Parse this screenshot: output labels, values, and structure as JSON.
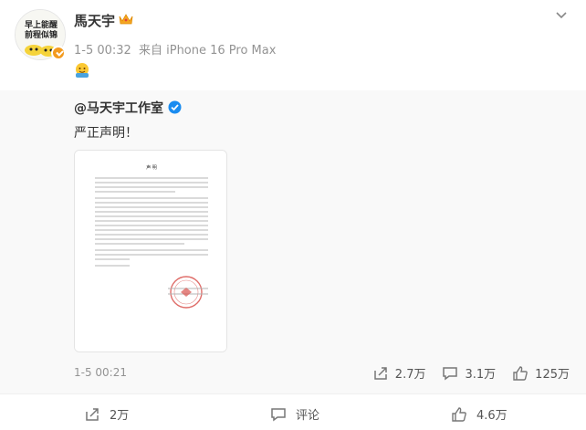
{
  "author": {
    "name": "馬天宇",
    "avatar_text_line1": "早上能醒",
    "avatar_text_line2": "前程似锦",
    "time": "1-5 00:32",
    "source": "来自 iPhone 16 Pro Max",
    "badge_icon": "crown-icon",
    "verify_color": "#f39a1e"
  },
  "repost": {
    "author": "@马天宇工作室",
    "text": "严正声明！",
    "document_title": "声 明",
    "time": "1-5 00:21",
    "stats": {
      "reposts": "2.7万",
      "comments": "3.1万",
      "likes": "125万"
    }
  },
  "footer": {
    "repost_count": "2万",
    "comment_label": "评论",
    "like_count": "4.6万"
  },
  "colors": {
    "verified_blue": "#1a8cf0",
    "meta_gray": "#939393",
    "repost_bg": "#f9f9f9",
    "stamp_red": "#d9534f"
  }
}
